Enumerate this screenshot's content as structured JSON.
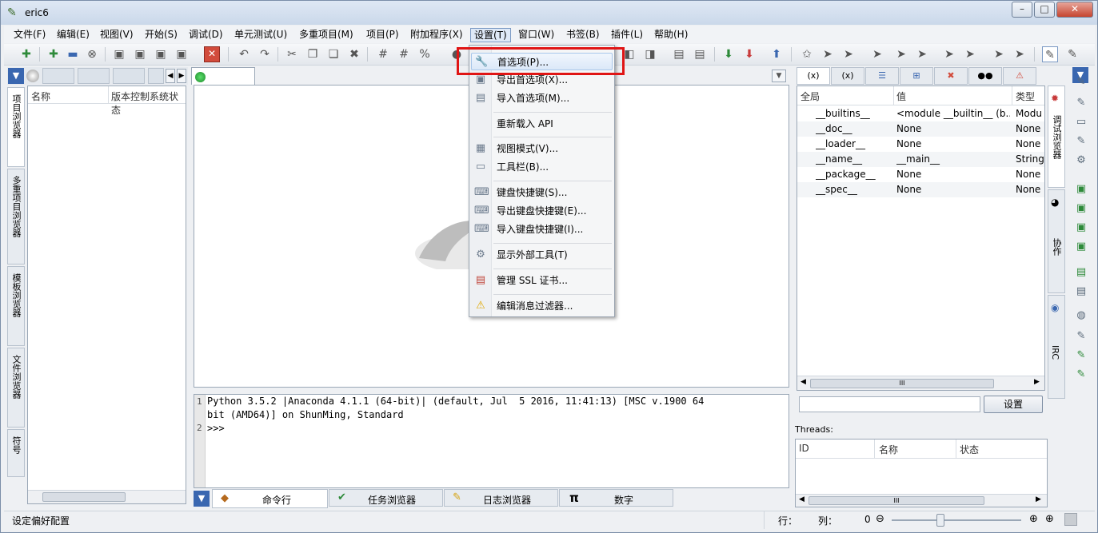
{
  "window": {
    "title": "eric6",
    "min": "–",
    "max": "□",
    "close": "✕"
  },
  "menubar": [
    "文件(F)",
    "编辑(E)",
    "视图(V)",
    "开始(S)",
    "调试(D)",
    "单元测试(U)",
    "多重项目(M)",
    "项目(P)",
    "附加程序(X)",
    "设置(T)",
    "窗口(W)",
    "书签(B)",
    "插件(L)",
    "帮助(H)"
  ],
  "left_dock": {
    "vtabs": [
      "项目浏览器",
      "多重项目浏览器",
      "模板浏览器",
      "文件浏览器",
      "符号"
    ],
    "columns": [
      "名称",
      "版本控制系统状态"
    ]
  },
  "shell": {
    "lines": [
      {
        "no": "1",
        "text": "Python 3.5.2 |Anaconda 4.1.1 (64-bit)| (default, Jul  5 2016, 11:41:13) [MSC v.1900 64"
      },
      {
        "no": "",
        "text": "bit (AMD64)] on ShunMing, Standard"
      },
      {
        "no": "2",
        "text": ">>>"
      }
    ]
  },
  "bottom_tabs": [
    "命令行",
    "任务浏览器",
    "日志浏览器",
    "数字"
  ],
  "variables": {
    "tabs": [
      "(x)",
      "(x)",
      "",
      "",
      "",
      "",
      ""
    ],
    "columns": [
      "全局",
      "值",
      "类型"
    ],
    "rows": [
      {
        "name": "__builtins__",
        "value": "<module __builtin__ (b...",
        "type": "Modu"
      },
      {
        "name": "__doc__",
        "value": "None",
        "type": "None"
      },
      {
        "name": "__loader__",
        "value": "None",
        "type": "None"
      },
      {
        "name": "__name__",
        "value": "__main__",
        "type": "String"
      },
      {
        "name": "__package__",
        "value": "None",
        "type": "None"
      },
      {
        "name": "__spec__",
        "value": "None",
        "type": "None"
      }
    ],
    "scroll_label": "III",
    "set_button": "设置"
  },
  "threads": {
    "label": "Threads:",
    "columns": [
      "ID",
      "名称",
      "状态"
    ],
    "scroll_label": "III"
  },
  "right_vtabs": [
    "调试浏览器",
    "协作",
    "IRC"
  ],
  "dropdown": {
    "items": [
      {
        "label": "首选项(P)...",
        "icon": "wrench-icon",
        "glyph": "🔧"
      },
      {
        "label": "导出首选项(X)...",
        "icon": "export-icon",
        "glyph": "▣"
      },
      {
        "label": "导入首选项(M)...",
        "icon": "import-icon",
        "glyph": "▤"
      },
      {
        "label": "重新载入 API",
        "icon": "",
        "glyph": ""
      },
      {
        "label": "视图模式(V)...",
        "icon": "view-mode-icon",
        "glyph": "▦"
      },
      {
        "label": "工具栏(B)...",
        "icon": "toolbar-icon",
        "glyph": "▭"
      },
      {
        "label": "键盘快捷键(S)...",
        "icon": "keyboard-icon",
        "glyph": "⌨"
      },
      {
        "label": "导出键盘快捷键(E)...",
        "icon": "export-keyboard-icon",
        "glyph": "⌨"
      },
      {
        "label": "导入键盘快捷键(I)...",
        "icon": "import-keyboard-icon",
        "glyph": "⌨"
      },
      {
        "label": "显示外部工具(T)",
        "icon": "gear-icon",
        "glyph": "⚙"
      },
      {
        "label": "管理 SSL 证书...",
        "icon": "certificate-icon",
        "glyph": "▤"
      },
      {
        "label": "编辑消息过滤器...",
        "icon": "warning-icon",
        "glyph": "⚠"
      }
    ]
  },
  "statusbar": {
    "text": "设定偏好配置",
    "line_label": "行：",
    "col_label": "列：",
    "zoom": "0"
  },
  "colors": {
    "highlight_box": "#e01515",
    "accent": "#3a67b0"
  }
}
